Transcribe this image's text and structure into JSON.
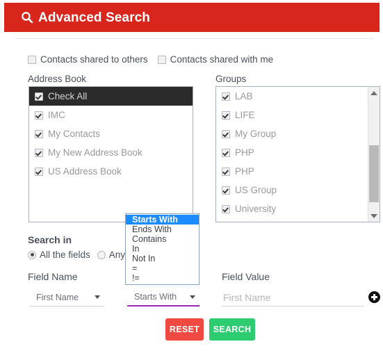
{
  "header": {
    "title": "Advanced Search",
    "icon": "search-icon",
    "background_color": "#d9261c",
    "text_color": "#ffffff"
  },
  "shared_filters": [
    {
      "label": "Contacts shared to others",
      "checked": false
    },
    {
      "label": "Contacts shared with me",
      "checked": false
    }
  ],
  "address_book": {
    "label": "Address Book",
    "items": [
      {
        "label": "Check All",
        "checked": true,
        "selected": true
      },
      {
        "label": "IMC",
        "checked": true,
        "selected": false
      },
      {
        "label": "My Contacts",
        "checked": true,
        "selected": false
      },
      {
        "label": "My New Address Book",
        "checked": true,
        "selected": false
      },
      {
        "label": "US Address Book",
        "checked": true,
        "selected": false
      }
    ]
  },
  "groups": {
    "label": "Groups",
    "items": [
      {
        "label": "LAB",
        "checked": true
      },
      {
        "label": "LIFE",
        "checked": true
      },
      {
        "label": "My Group",
        "checked": true
      },
      {
        "label": "PHP",
        "checked": true
      },
      {
        "label": "PHP",
        "checked": true
      },
      {
        "label": "US Group",
        "checked": true
      },
      {
        "label": "University",
        "checked": true
      }
    ],
    "scrollbar": {
      "up_arrow": "triangle-up-icon",
      "down_arrow": "triangle-down-icon"
    }
  },
  "search_in": {
    "label": "Search in",
    "options": [
      {
        "label": "All the fields",
        "selected": true
      },
      {
        "label": "Any",
        "selected": false
      }
    ]
  },
  "field_row": {
    "field_name_label": "Field Name",
    "field_value_label": "Field Value",
    "field_name_value": "First Name",
    "operator_value": "Starts With",
    "field_value_placeholder": "First Name",
    "field_value_text": "",
    "add_button_icon": "plus-circle-icon",
    "focus_color": "#9c27b0"
  },
  "operator_dropdown": {
    "open": true,
    "highlighted": "Starts With",
    "highlight_color": "#1a8cff",
    "options": [
      "Starts With",
      "Ends With",
      "Contains",
      "In",
      "Not In",
      "=",
      "!="
    ]
  },
  "actions": {
    "reset_label": "RESET",
    "reset_color": "#ef4a42",
    "search_label": "SEARCH",
    "search_color": "#2ecc71"
  }
}
